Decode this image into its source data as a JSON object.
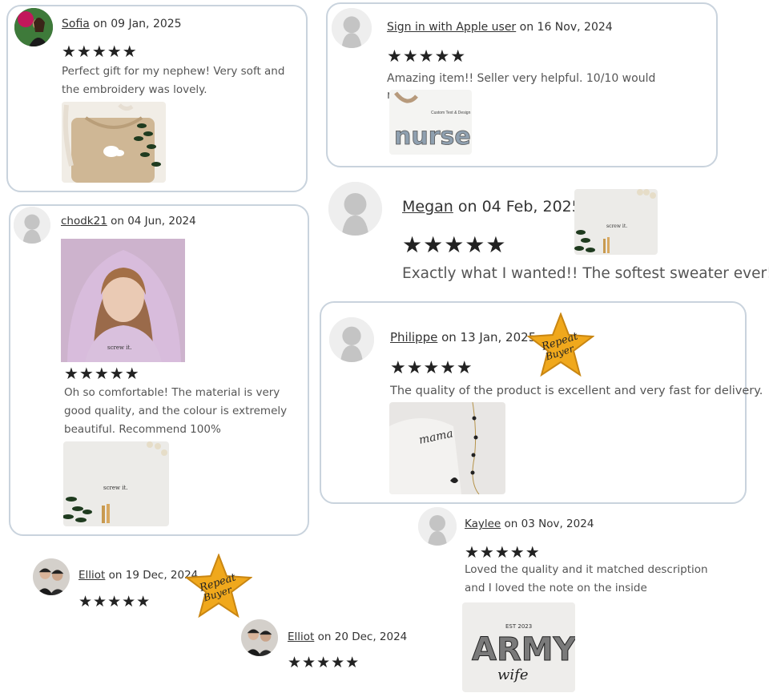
{
  "reviews": [
    {
      "name": "Sofia",
      "date": " on 09 Jan, 2025",
      "stars": "★★★★★",
      "text": "Perfect gift for my nephew! Very soft and the embroidery was lovely."
    },
    {
      "name": "Sign in with Apple user",
      "date": " on 16 Nov, 2024",
      "stars": "★★★★★",
      "text": "Amazing item!! Seller very helpful. 10/10 would recommend",
      "photo_text": {
        "caption": "Custom Text & Design",
        "word": "nurse"
      }
    },
    {
      "name": "chodk21",
      "date": " on 04 Jun, 2024",
      "stars": "★★★★★",
      "text": "Oh so comfortable! The material is very good quality, and the colour is extremely beautiful. Recommend 100%",
      "photo_text": "screw it."
    },
    {
      "name": "Megan",
      "date": " on 04 Feb, 2025",
      "stars": "★★★★★",
      "text": "Exactly what I wanted!! The softest sweater ever!!",
      "photo_text": "screw it."
    },
    {
      "name": "Philippe",
      "date": " on 13 Jan, 2025",
      "stars": "★★★★★",
      "text": "The quality of the product is excellent and very fast for delivery.",
      "photo_text": "mama"
    },
    {
      "name": "Kaylee",
      "date": " on 03 Nov, 2024",
      "stars": "★★★★★",
      "text": "Loved the quality and it matched description and I loved the note on the inside",
      "photo_text": {
        "top": "EST 2023",
        "word": "ARMY",
        "script": "wife"
      }
    },
    {
      "name": "Elliot",
      "date": " on 19 Dec, 2024",
      "stars": "★★★★★"
    },
    {
      "name": "Elliot",
      "date": " on 20 Dec, 2024",
      "stars": "★★★★★"
    }
  ],
  "badges": [
    {
      "line1": "Repeat",
      "line2": "Buyer"
    },
    {
      "line1": "Repeat",
      "line2": "Buyer"
    }
  ],
  "colors": {
    "card_border": "#c9d3dd",
    "star": "#222222",
    "badge_gold": "#f0a81c",
    "link": "#333333"
  }
}
